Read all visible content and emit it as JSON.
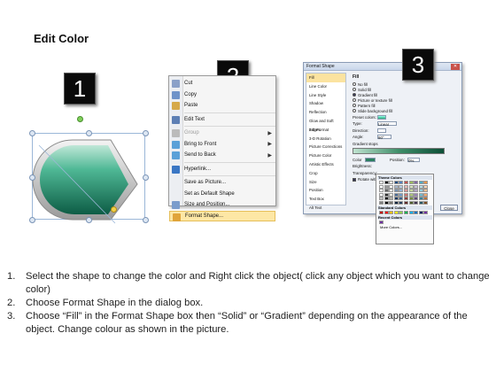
{
  "title": "Edit Color",
  "badges": [
    "1",
    "2",
    "3"
  ],
  "context_menu": {
    "items": [
      {
        "label": "Cut",
        "disabled": false,
        "submenu": false,
        "highlighted": false,
        "icon": "scissors-icon"
      },
      {
        "label": "Copy",
        "disabled": false,
        "submenu": false,
        "highlighted": false,
        "icon": "copy-icon"
      },
      {
        "label": "Paste",
        "disabled": false,
        "submenu": false,
        "highlighted": false,
        "icon": "paste-icon"
      },
      {
        "label": "Edit Text",
        "disabled": false,
        "submenu": false,
        "highlighted": false,
        "icon": "edit-text-icon"
      },
      {
        "label": "Group",
        "disabled": true,
        "submenu": true,
        "highlighted": false,
        "icon": "group-icon"
      },
      {
        "label": "Bring to Front",
        "disabled": false,
        "submenu": true,
        "highlighted": false,
        "icon": "bring-front-icon"
      },
      {
        "label": "Send to Back",
        "disabled": false,
        "submenu": true,
        "highlighted": false,
        "icon": "send-back-icon"
      },
      {
        "label": "Hyperlink...",
        "disabled": false,
        "submenu": false,
        "highlighted": false,
        "icon": "hyperlink-icon"
      },
      {
        "label": "Save as Picture...",
        "disabled": false,
        "submenu": false,
        "highlighted": false,
        "icon": ""
      },
      {
        "label": "Set as Default Shape",
        "disabled": false,
        "submenu": false,
        "highlighted": false,
        "icon": ""
      },
      {
        "label": "Size and Position...",
        "disabled": false,
        "submenu": false,
        "highlighted": false,
        "icon": "size-position-icon"
      },
      {
        "label": "Format Shape...",
        "disabled": false,
        "submenu": false,
        "highlighted": true,
        "icon": "format-shape-icon"
      }
    ]
  },
  "format_dialog": {
    "title": "Format Shape",
    "categories": [
      "Fill",
      "Line Color",
      "Line Style",
      "Shadow",
      "Reflection",
      "Glow and Soft Edges",
      "3-D Format",
      "3-D Rotation",
      "Picture Corrections",
      "Picture Color",
      "Artistic Effects",
      "Crop",
      "Size",
      "Position",
      "Text Box",
      "Alt Text"
    ],
    "selected_category": "Fill",
    "fill_heading": "Fill",
    "fill_options": [
      {
        "label": "No fill",
        "checked": false
      },
      {
        "label": "Solid fill",
        "checked": false
      },
      {
        "label": "Gradient fill",
        "checked": true
      },
      {
        "label": "Picture or texture fill",
        "checked": false
      },
      {
        "label": "Pattern fill",
        "checked": false
      },
      {
        "label": "Slide background fill",
        "checked": false
      }
    ],
    "fields": {
      "preset_label": "Preset colors:",
      "type_label": "Type:",
      "type_value": "Linear",
      "direction_label": "Direction:",
      "angle_label": "Angle:",
      "angle_value": "90°",
      "stops_label": "Gradient stops",
      "color_label": "Color",
      "position_label": "Position:",
      "position_value": "0%",
      "brightness_label": "Brightness:",
      "transparency_label": "Transparency:",
      "rotate_label": "Rotate with shape"
    },
    "close_label": "Close",
    "color_popup": {
      "theme_heading": "Theme Colors",
      "standard_heading": "Standard Colors",
      "recent_heading": "Recent Colors",
      "more_label": "More Colors...",
      "theme_top": [
        "#ffffff",
        "#000000",
        "#eeece1",
        "#1f497d",
        "#4f81bd",
        "#c0504d",
        "#9bbb59",
        "#8064a2",
        "#4bacc6",
        "#f79646"
      ],
      "standard": [
        "#c00000",
        "#ff0000",
        "#ffc000",
        "#ffff00",
        "#92d050",
        "#00b050",
        "#00b0f0",
        "#0070c0",
        "#002060",
        "#7030a0"
      ],
      "recent": [
        "#7030a0"
      ]
    }
  },
  "steps": [
    {
      "n": "1.",
      "text": "Select the shape to change the color and Right click the object( click any object which you want to change color)"
    },
    {
      "n": "2.",
      "text": "Choose Format Shape in the dialog box."
    },
    {
      "n": "3.",
      "text": "Choose “Fill” in the Format Shape box then “Solid” or “Gradient” depending on the appearance of the object. Change colour as shown in the picture."
    }
  ],
  "colors": {
    "shape_dark": "#0d5c45",
    "shape_light": "#7fd0b2",
    "highlight": "#fde7a5",
    "badge": "#0a0a0a"
  }
}
